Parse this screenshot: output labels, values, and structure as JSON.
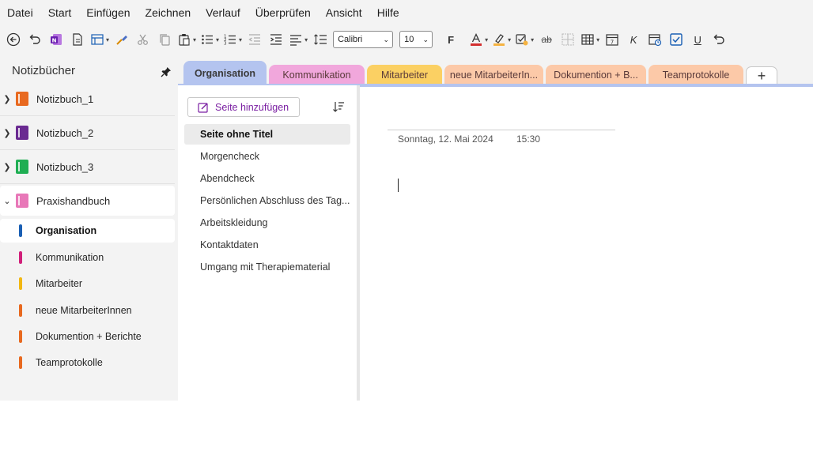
{
  "menu": [
    "Datei",
    "Start",
    "Einfügen",
    "Zeichnen",
    "Verlauf",
    "Überprüfen",
    "Ansicht",
    "Hilfe"
  ],
  "ribbon": {
    "font_name": "Calibri",
    "font_size": "10",
    "bold_label": "F",
    "italic_label": "K",
    "underline_label": "U",
    "strikethrough_label": "ab",
    "font_color": "#d32f2f",
    "highlight_color": "#f5b342"
  },
  "sidebar": {
    "title": "Notizbücher",
    "notebooks": [
      {
        "label": "Notizbuch_1",
        "color": "#e8691f",
        "expanded": false
      },
      {
        "label": "Notizbuch_2",
        "color": "#6a2a91",
        "expanded": false
      },
      {
        "label": "Notizbuch_3",
        "color": "#1fae53",
        "expanded": false
      },
      {
        "label": "Praxishandbuch",
        "color": "#e878b8",
        "expanded": true
      }
    ],
    "sections": [
      {
        "label": "Organisation",
        "color": "#1a5fb4",
        "active": true
      },
      {
        "label": "Kommunikation",
        "color": "#d11f7a",
        "active": false
      },
      {
        "label": "Mitarbeiter",
        "color": "#f2b712",
        "active": false
      },
      {
        "label": "neue MitarbeiterInnen",
        "color": "#e8691f",
        "active": false
      },
      {
        "label": "Dokumention + Berichte",
        "color": "#e8691f",
        "active": false
      },
      {
        "label": "Teamprotokolle",
        "color": "#e8691f",
        "active": false
      }
    ]
  },
  "tabs": [
    {
      "label": "Organisation",
      "color": "#b4c4ef",
      "active": true
    },
    {
      "label": "Kommunikation",
      "color": "#f1a7dc",
      "active": false
    },
    {
      "label": "Mitarbeiter",
      "color": "#fbd063",
      "active": false
    },
    {
      "label": "neue MitarbeiterIn...",
      "color": "#fcc9a8",
      "active": false
    },
    {
      "label": "Dokumention + B...",
      "color": "#fcc9a8",
      "active": false
    },
    {
      "label": "Teamprotokolle",
      "color": "#fcc9a8",
      "active": false
    }
  ],
  "tab_add_label": "+",
  "pagelist": {
    "add_page_label": "Seite hinzufügen",
    "pages": [
      {
        "label": "Seite ohne Titel",
        "active": true
      },
      {
        "label": "Morgencheck",
        "active": false
      },
      {
        "label": "Abendcheck",
        "active": false
      },
      {
        "label": "Persönlichen Abschluss des Tag...",
        "active": false
      },
      {
        "label": "Arbeitskleidung",
        "active": false
      },
      {
        "label": "Kontaktdaten",
        "active": false
      },
      {
        "label": "Umgang mit Therapiematerial",
        "active": false
      }
    ]
  },
  "page": {
    "date": "Sonntag, 12. Mai 2024",
    "time": "15:30"
  }
}
